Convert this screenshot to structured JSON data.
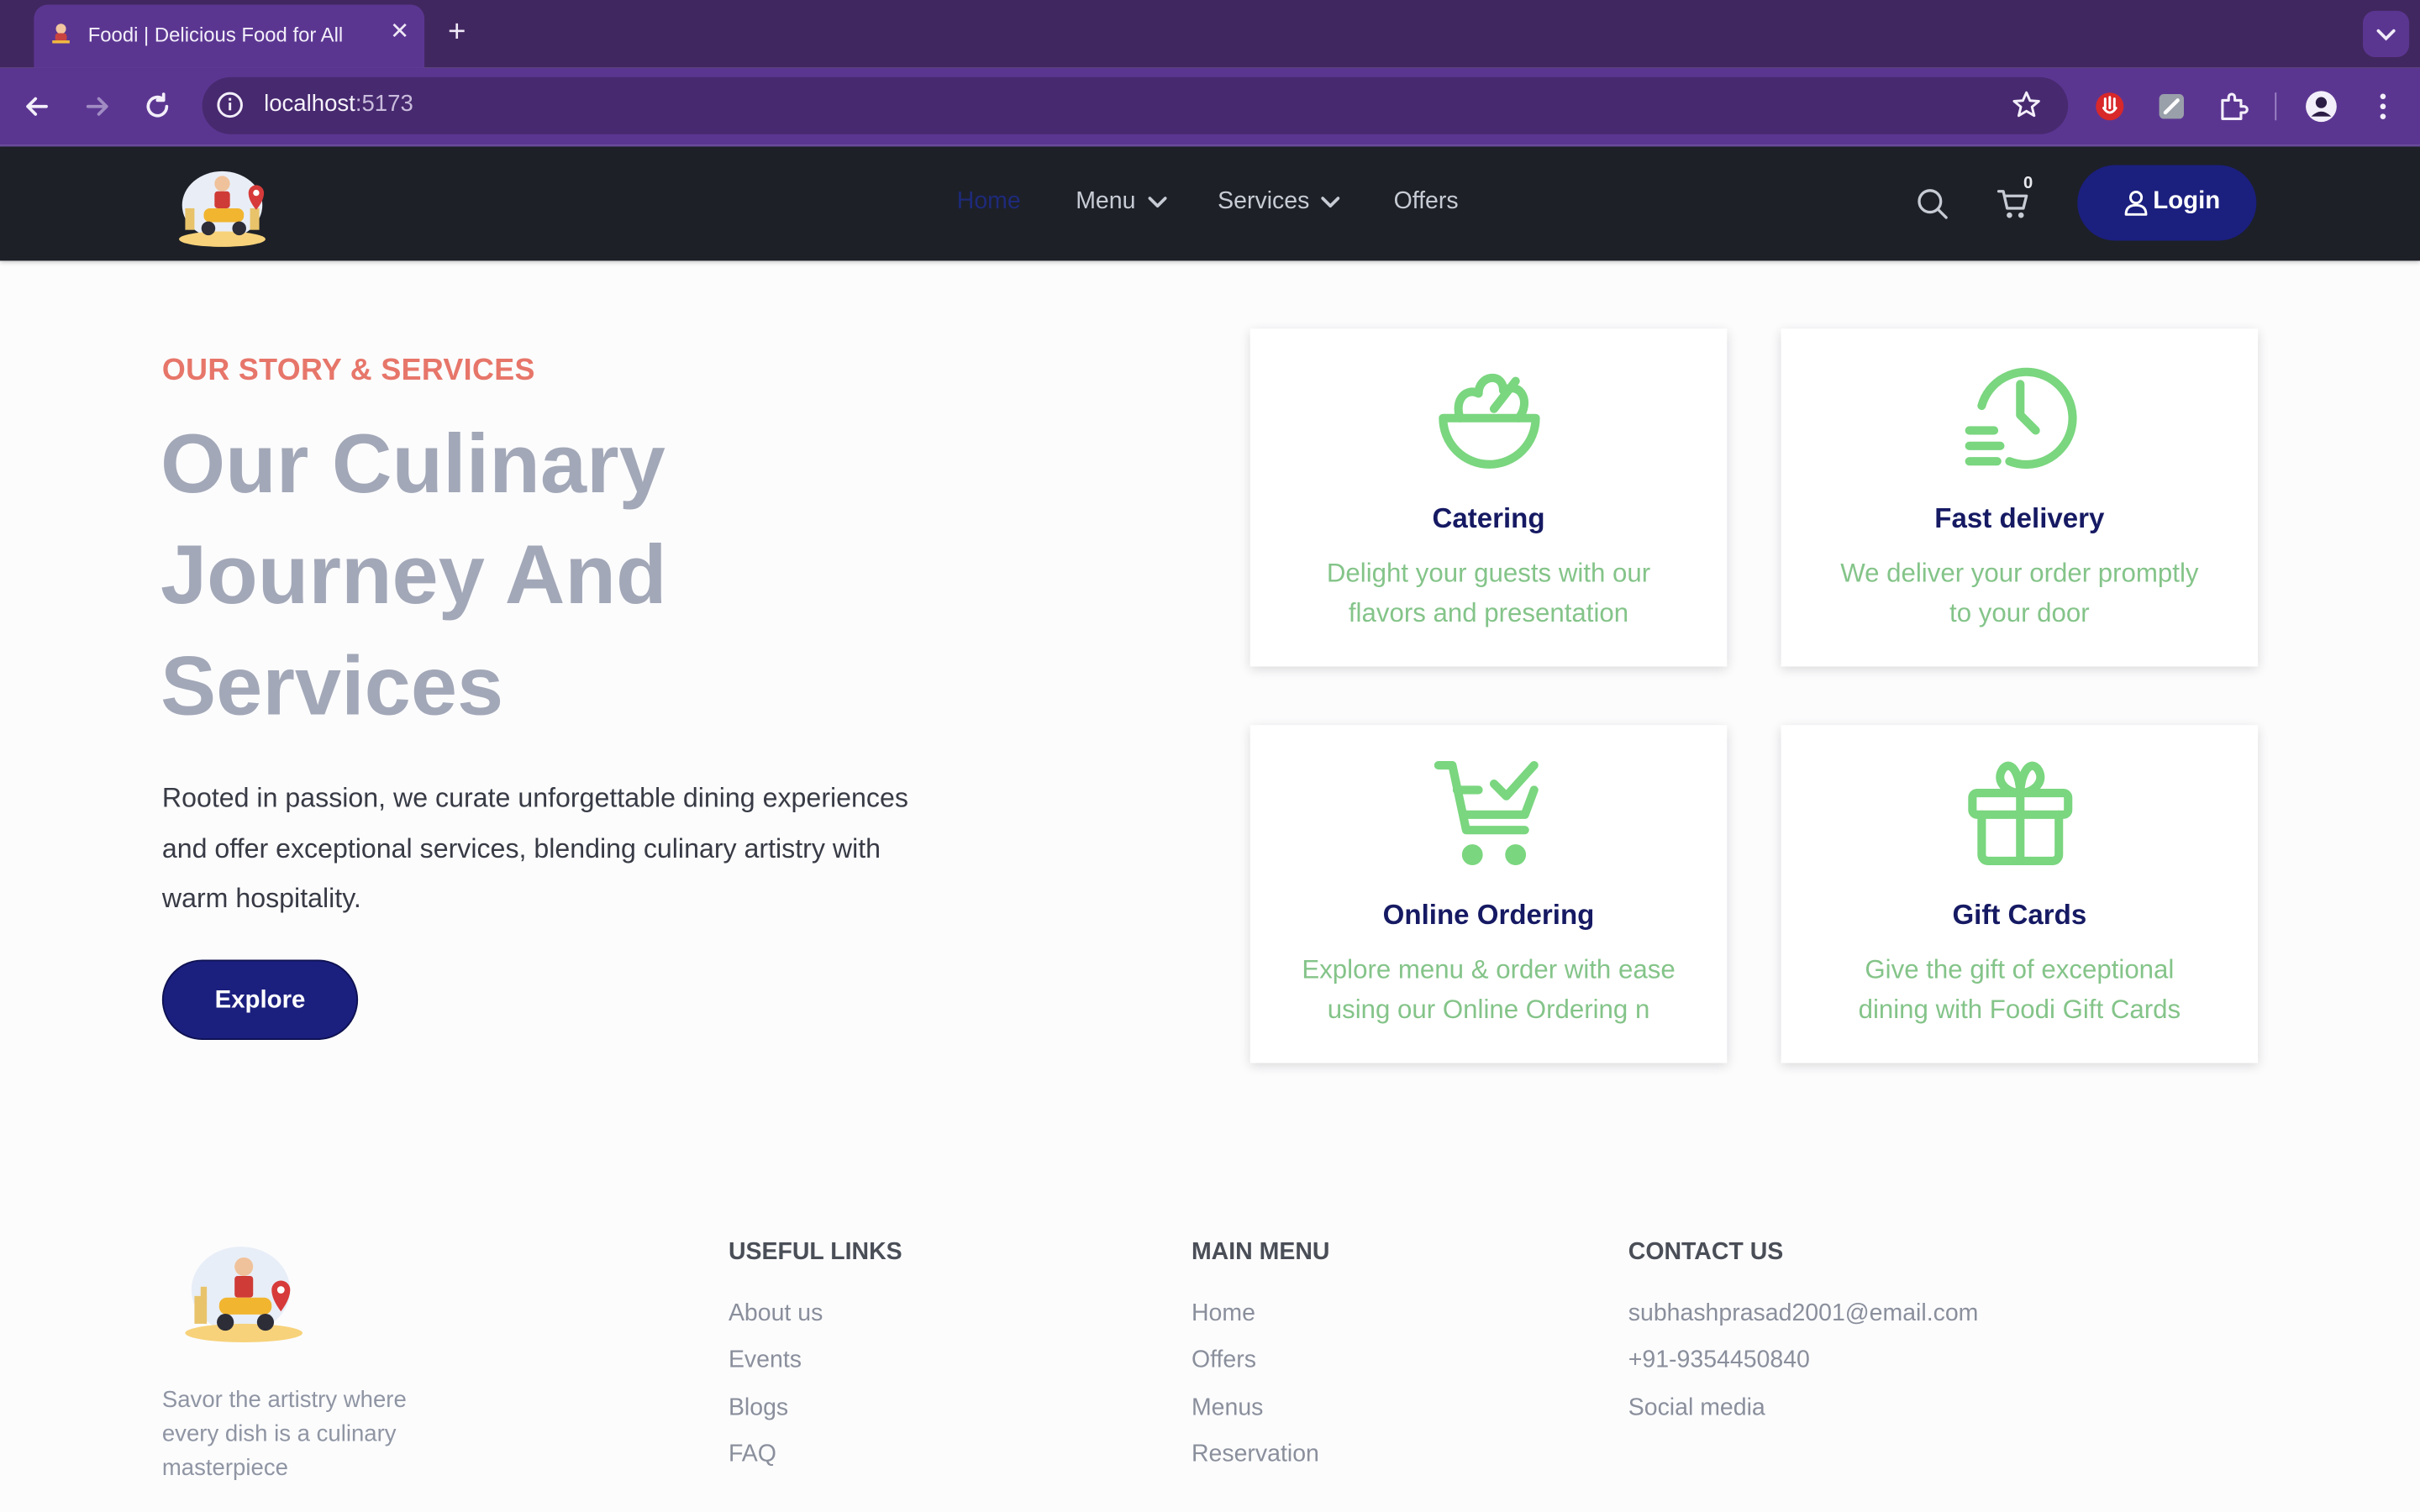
{
  "browser": {
    "tab_title": "Foodi | Delicious Food for All",
    "url_host": "localhost",
    "url_port": ":5173",
    "new_tab_symbol": "+",
    "close_symbol": "✕"
  },
  "nav": {
    "items": [
      {
        "label": "Home",
        "active": true
      },
      {
        "label": "Menu",
        "has_dropdown": true
      },
      {
        "label": "Services",
        "has_dropdown": true
      },
      {
        "label": "Offers"
      }
    ],
    "cart_count": "0",
    "login_label": "Login"
  },
  "hero": {
    "eyebrow": "OUR STORY & SERVICES",
    "headline_lines": [
      "Our Culinary",
      "Journey And",
      "Services"
    ],
    "description_lines": [
      "Rooted in passion, we curate unforgettable dining experiences",
      "and offer exceptional services, blending culinary artistry with",
      "warm hospitality."
    ],
    "cta_label": "Explore"
  },
  "services": [
    {
      "icon": "salad-bowl-icon",
      "title": "Catering",
      "desc_lines": [
        "Delight your guests with our",
        "flavors and presentation"
      ]
    },
    {
      "icon": "fast-delivery-clock-icon",
      "title": "Fast delivery",
      "desc_lines": [
        "We deliver your order promptly",
        "to your door"
      ]
    },
    {
      "icon": "shopping-cart-check-icon",
      "title": "Online Ordering",
      "desc_lines": [
        "Explore menu & order with ease",
        "using our Online Ordering n"
      ]
    },
    {
      "icon": "gift-icon",
      "title": "Gift Cards",
      "desc_lines": [
        "Give the gift of exceptional",
        "dining with Foodi Gift Cards"
      ]
    }
  ],
  "footer": {
    "tagline_lines": [
      "Savor the artistry where",
      "every dish is a culinary",
      "masterpiece"
    ],
    "columns": [
      {
        "title": "USEFUL LINKS",
        "links": [
          "About us",
          "Events",
          "Blogs",
          "FAQ"
        ]
      },
      {
        "title": "MAIN MENU",
        "links": [
          "Home",
          "Offers",
          "Menus",
          "Reservation"
        ]
      },
      {
        "title": "CONTACT US",
        "links": [
          "subhashprasad2001@email.com",
          "+91-9354450840",
          "Social media"
        ]
      }
    ]
  },
  "colors": {
    "accent": "#1b1f7e",
    "eyebrow": "#e7766a",
    "icon_green": "#7ad67f",
    "card_text_green": "#84c489",
    "nav_bg": "#1d2027",
    "browser_frame": "#5b3691"
  }
}
